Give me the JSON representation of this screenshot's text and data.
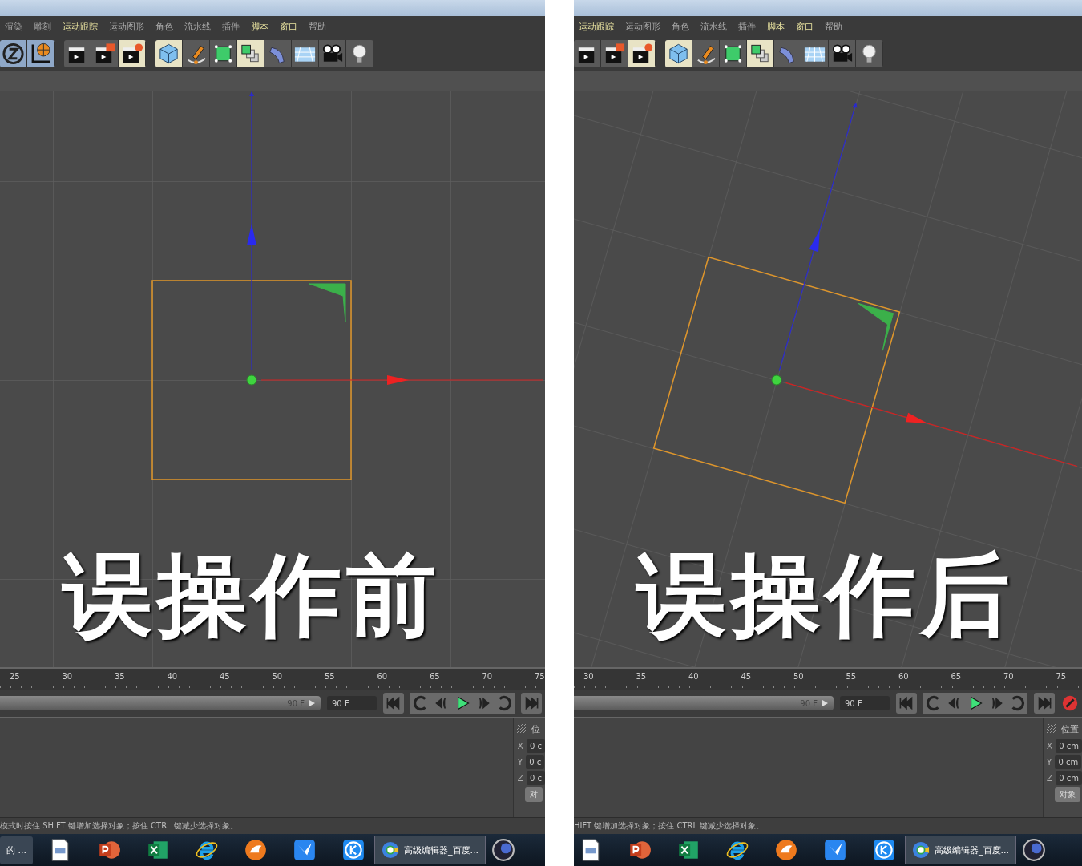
{
  "panels": [
    {
      "rotated": false,
      "caption": "误操作前",
      "menu": [
        {
          "label": "渲染",
          "highlighted": false
        },
        {
          "label": "雕刻",
          "highlighted": false
        },
        {
          "label": "运动跟踪",
          "highlighted": true
        },
        {
          "label": "运动图形",
          "highlighted": false
        },
        {
          "label": "角色",
          "highlighted": false
        },
        {
          "label": "流水线",
          "highlighted": false
        },
        {
          "label": "插件",
          "highlighted": false
        },
        {
          "label": "脚本",
          "highlighted": true
        },
        {
          "label": "窗口",
          "highlighted": true
        },
        {
          "label": "帮助",
          "highlighted": false
        }
      ],
      "ruler": [
        "25",
        "30",
        "35",
        "40",
        "45",
        "50",
        "55",
        "60",
        "65",
        "70",
        "75"
      ],
      "frame_end": "90 F",
      "frame_field": "90 F",
      "coord_header": "位",
      "coords": [
        {
          "axis": "X",
          "value": "0 c"
        },
        {
          "axis": "Y",
          "value": "0 c"
        },
        {
          "axis": "Z",
          "value": "0 c"
        }
      ],
      "object_button": "对",
      "status": "模式时按住 SHIFT 键增加选择对象；按住 CTRL 键减少选择对象。",
      "taskbar_window": "的 ...",
      "taskbar_task": "高级编辑器_百度..."
    },
    {
      "rotated": true,
      "caption": "误操作后",
      "menu": [
        {
          "label": "运动跟踪",
          "highlighted": true
        },
        {
          "label": "运动图形",
          "highlighted": false
        },
        {
          "label": "角色",
          "highlighted": false
        },
        {
          "label": "流水线",
          "highlighted": false
        },
        {
          "label": "插件",
          "highlighted": false
        },
        {
          "label": "脚本",
          "highlighted": true
        },
        {
          "label": "窗口",
          "highlighted": true
        },
        {
          "label": "帮助",
          "highlighted": false
        }
      ],
      "ruler": [
        "30",
        "35",
        "40",
        "45",
        "50",
        "55",
        "60",
        "65",
        "70",
        "75"
      ],
      "frame_end": "90 F",
      "frame_field": "90 F",
      "coord_header": "位置",
      "coords": [
        {
          "axis": "X",
          "value": "0 cm"
        },
        {
          "axis": "Y",
          "value": "0 cm"
        },
        {
          "axis": "Z",
          "value": "0 cm"
        }
      ],
      "object_button": "对象",
      "status": "HIFT 键增加选择对象；按住 CTRL 键减少选择对象。",
      "taskbar_task": "高级编辑器_百度..."
    }
  ]
}
